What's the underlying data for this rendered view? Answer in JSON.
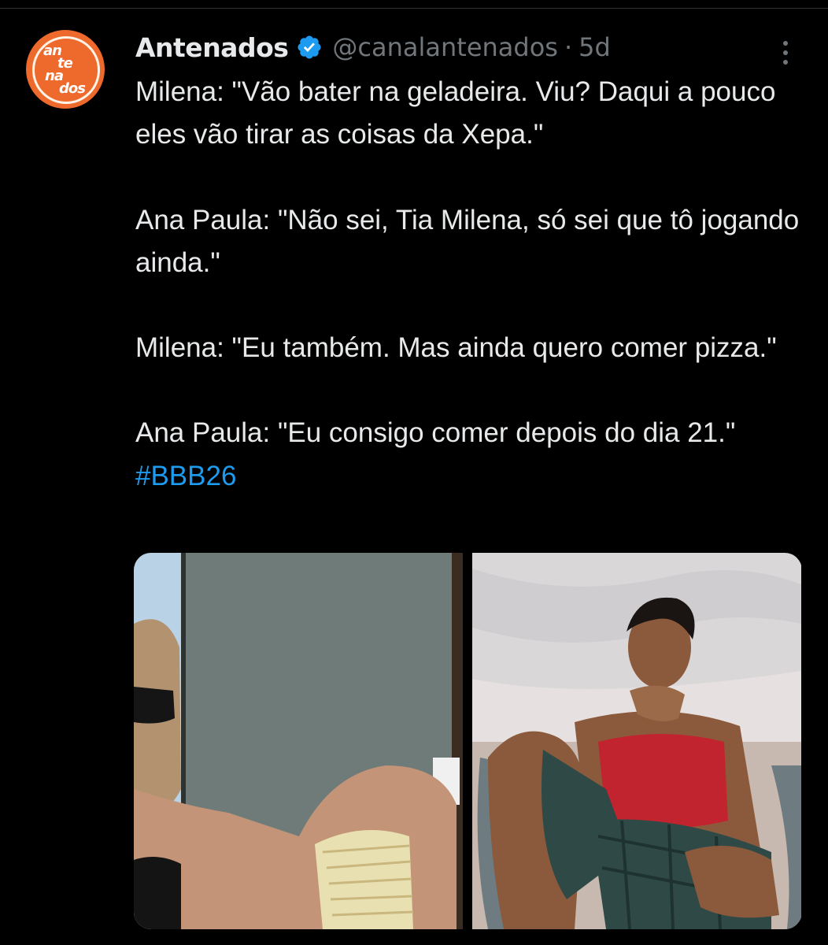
{
  "tweet": {
    "author": {
      "display_name": "Antenados",
      "handle": "@canalantenados",
      "verified": true,
      "avatar_text": "antenados"
    },
    "separator": "·",
    "time": "5d",
    "lines": [
      "Milena: \"Vão bater na geladeira. Viu? Daqui a pouco eles vão tirar as coisas da Xepa.\"",
      "Ana Paula: \"Não sei, Tia Milena, só sei que tô jogando ainda.\"",
      "Milena: \"Eu também. Mas ainda quero comer pizza.\"",
      "Ana Paula: \"Eu consigo comer depois do dia 21.\""
    ],
    "hashtag": "#BBB26"
  },
  "icons": {
    "verified": "verified-badge-icon",
    "more": "more-options-icon"
  },
  "colors": {
    "background": "#000000",
    "text": "#e7e9ea",
    "secondary": "#71767b",
    "link": "#1d9bf0",
    "avatar": "#ee6a2c"
  }
}
